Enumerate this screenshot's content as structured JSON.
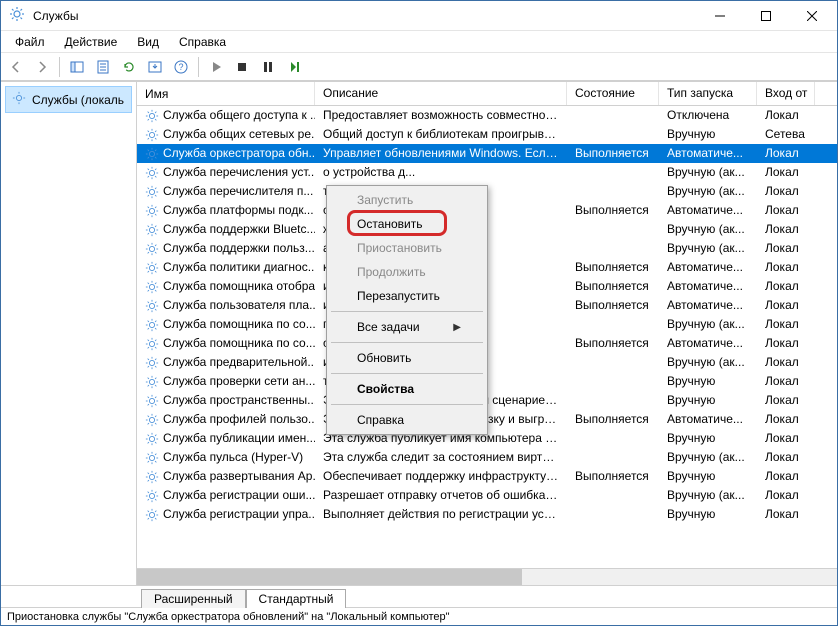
{
  "title": "Службы",
  "menubar": [
    "Файл",
    "Действие",
    "Вид",
    "Справка"
  ],
  "tree_item": "Службы (локаль",
  "columns": {
    "name": "Имя",
    "desc": "Описание",
    "state": "Состояние",
    "start": "Тип запуска",
    "logon": "Вход от"
  },
  "tabs": {
    "extended": "Расширенный",
    "standard": "Стандартный"
  },
  "statusbar": "Приостановка службы \"Служба оркестратора обновлений\" на \"Локальный компьютер\"",
  "context_menu": {
    "start": "Запустить",
    "stop": "Остановить",
    "pause": "Приостановить",
    "resume": "Продолжить",
    "restart": "Перезапустить",
    "all_tasks": "Все задачи",
    "refresh": "Обновить",
    "properties": "Свойства",
    "help": "Справка"
  },
  "rows": [
    {
      "name": "Служба общего доступа к ...",
      "desc": "Предоставляет возможность совместного ...",
      "state": "",
      "start": "Отключена",
      "logon": "Локал"
    },
    {
      "name": "Служба общих сетевых ре...",
      "desc": "Общий доступ к библиотекам проигрыват...",
      "state": "",
      "start": "Вручную",
      "logon": "Сетева"
    },
    {
      "name": "Служба оркестратора обн...",
      "desc": "Управляет обновлениями Windows. Если ...",
      "state": "Выполняется",
      "start": "Автоматиче...",
      "logon": "Локал",
      "selected": true
    },
    {
      "name": "Служба перечисления уст...",
      "desc": "о устройства д...",
      "state": "",
      "start": "Вручную (ак...",
      "logon": "Локал"
    },
    {
      "name": "Служба перечислителя п...",
      "desc": "тику к съемн...",
      "state": "",
      "start": "Вручную (ак...",
      "logon": "Локал"
    },
    {
      "name": "Служба платформы подк...",
      "desc": "сценариев пла...",
      "state": "Выполняется",
      "start": "Автоматиче...",
      "logon": "Локал"
    },
    {
      "name": "Служба поддержки Bluetc...",
      "desc": "живает обнару...",
      "state": "",
      "start": "Вручную (ак...",
      "logon": "Локал"
    },
    {
      "name": "Служба поддержки польз...",
      "desc": "ателей Bluetoo...",
      "state": "",
      "start": "Вручную (ак...",
      "logon": "Локал"
    },
    {
      "name": "Служба политики диагнос...",
      "desc": "ки позволяет ...",
      "state": "Выполняется",
      "start": "Автоматиче...",
      "logon": "Локал"
    },
    {
      "name": "Служба помощника отобра...",
      "desc": "и конфигурац...",
      "state": "Выполняется",
      "start": "Автоматиче...",
      "logon": "Локал"
    },
    {
      "name": "Служба пользователя пла...",
      "desc": "и используетс...",
      "state": "Выполняется",
      "start": "Автоматиче...",
      "logon": "Локал"
    },
    {
      "name": "Служба помощника по со...",
      "desc": "правление про...",
      "state": "",
      "start": "Вручную (ак...",
      "logon": "Локал"
    },
    {
      "name": "Служба помощника по со...",
      "desc": "омощника по...",
      "state": "Выполняется",
      "start": "Автоматиче...",
      "logon": "Локал"
    },
    {
      "name": "Служба предварительной...",
      "desc": "инфраструктур...",
      "state": "",
      "start": "Вручную (ак...",
      "logon": "Локал"
    },
    {
      "name": "Служба проверки сети ан...",
      "desc": "токов вторже...",
      "state": "",
      "start": "Вручную",
      "logon": "Локал"
    },
    {
      "name": "Служба пространственны...",
      "desc": "Эта служба используется для сценариев п...",
      "state": "",
      "start": "Вручную",
      "logon": "Локал"
    },
    {
      "name": "Служба профилей пользо...",
      "desc": "Эта служба отвечает за загрузку и выгрузк...",
      "state": "Выполняется",
      "start": "Автоматиче...",
      "logon": "Локал"
    },
    {
      "name": "Служба публикации имен...",
      "desc": "Эта служба публикует имя компьютера п...",
      "state": "",
      "start": "Вручную",
      "logon": "Локал"
    },
    {
      "name": "Служба пульса (Hyper-V)",
      "desc": "Эта служба следит за состоянием виртуал...",
      "state": "",
      "start": "Вручную (ак...",
      "logon": "Локал"
    },
    {
      "name": "Служба развертывания Ар...",
      "desc": "Обеспечивает поддержку инфраструктур...",
      "state": "Выполняется",
      "start": "Вручную",
      "logon": "Локал"
    },
    {
      "name": "Служба регистрации оши...",
      "desc": "Разрешает отправку отчетов об ошибках ...",
      "state": "",
      "start": "Вручную (ак...",
      "logon": "Локал"
    },
    {
      "name": "Служба регистрации упра...",
      "desc": "Выполняет действия по регистрации устр...",
      "state": "",
      "start": "Вручную",
      "logon": "Локал"
    }
  ]
}
